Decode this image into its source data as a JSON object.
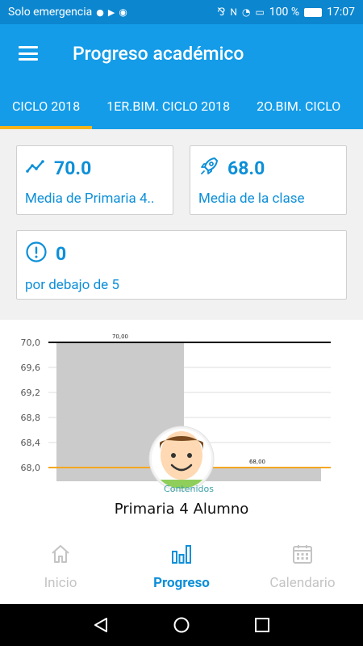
{
  "status_bar": {
    "carrier": "Solo emergencia",
    "battery": "100 %",
    "time": "17:07"
  },
  "header": {
    "title": "Progreso académico"
  },
  "tabs": [
    {
      "label": "CICLO 2018",
      "active": true
    },
    {
      "label": "1ER.BIM. CICLO 2018",
      "active": false
    },
    {
      "label": "2O.BIM. CICLO",
      "active": false
    }
  ],
  "cards": {
    "primaria": {
      "value": "70.0",
      "label": "Media de Primaria 4..",
      "icon": "trending-up-icon"
    },
    "clase": {
      "value": "68.0",
      "label": "Media de la clase",
      "icon": "rocket-icon"
    },
    "debajo": {
      "value": "0",
      "label": "por debajo de 5",
      "icon": "alert-circle-icon"
    }
  },
  "chart_data": {
    "type": "bar",
    "categories": [
      "Primaria 4 Alumno"
    ],
    "series": [
      {
        "values": [
          70.0
        ]
      },
      {
        "values": [
          68.0
        ]
      }
    ],
    "data_labels": [
      "70,00",
      "68,00"
    ],
    "y_ticks": [
      "70,0",
      "69,6",
      "69,2",
      "68,8",
      "68,4",
      "68,0"
    ],
    "ylim": [
      68.0,
      70.0
    ],
    "reference_lines": [
      {
        "value": 70.0,
        "color": "#000000"
      },
      {
        "value": 68.0,
        "color": "#f5a623"
      }
    ],
    "annotation": "Contenidos",
    "xlabel": "Primaria 4 Alumno",
    "grid": true
  },
  "bottom_nav": [
    {
      "label": "Inicio",
      "icon": "home-icon",
      "active": false
    },
    {
      "label": "Progreso",
      "icon": "bar-chart-icon",
      "active": true
    },
    {
      "label": "Calendario",
      "icon": "calendar-icon",
      "active": false
    }
  ],
  "colors": {
    "primary": "#149ce8",
    "accent": "#f4b41a",
    "text_primary": "#0d8fd8",
    "inactive": "#c4c4c4"
  }
}
